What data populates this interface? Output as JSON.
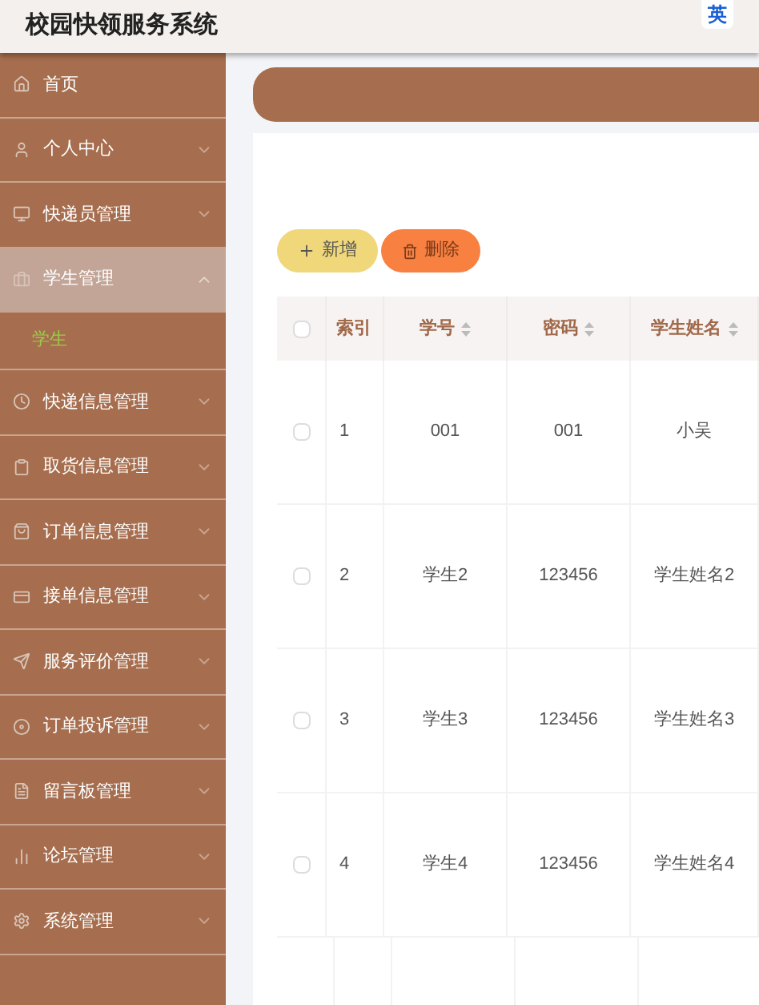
{
  "header": {
    "title": "校园快领服务系统",
    "ime_indicator": "英"
  },
  "sidebar": {
    "items": [
      {
        "label": "首页",
        "kind": "link",
        "selected": false
      },
      {
        "label": "个人中心",
        "kind": "menu",
        "selected": false,
        "expanded": false
      },
      {
        "label": "快递员管理",
        "kind": "menu",
        "selected": false,
        "expanded": false
      },
      {
        "label": "学生管理",
        "kind": "menu",
        "selected": true,
        "expanded": true,
        "children": [
          {
            "label": "学生",
            "selected": true
          }
        ]
      },
      {
        "label": "快递信息管理",
        "kind": "menu",
        "selected": false,
        "expanded": false
      },
      {
        "label": "取货信息管理",
        "kind": "menu",
        "selected": false,
        "expanded": false
      },
      {
        "label": "订单信息管理",
        "kind": "menu",
        "selected": false,
        "expanded": false
      },
      {
        "label": "接单信息管理",
        "kind": "menu",
        "selected": false,
        "expanded": false
      },
      {
        "label": "服务评价管理",
        "kind": "menu",
        "selected": false,
        "expanded": false
      },
      {
        "label": "订单投诉管理",
        "kind": "menu",
        "selected": false,
        "expanded": false
      },
      {
        "label": "留言板管理",
        "kind": "menu",
        "selected": false,
        "expanded": false
      },
      {
        "label": "论坛管理",
        "kind": "menu",
        "selected": false,
        "expanded": false
      },
      {
        "label": "系统管理",
        "kind": "menu",
        "selected": false,
        "expanded": false
      }
    ]
  },
  "toolbar": {
    "buttons": [
      {
        "label": "新增",
        "kind": "add"
      },
      {
        "label": "删除",
        "kind": "delete"
      }
    ]
  },
  "table": {
    "select_all_checked": false,
    "columns": [
      {
        "label": "索引",
        "sortable": false
      },
      {
        "label": "学号",
        "sortable": true
      },
      {
        "label": "密码",
        "sortable": true
      },
      {
        "label": "学生姓名",
        "sortable": true
      }
    ],
    "rows": [
      {
        "checked": false,
        "cells": [
          "1",
          "001",
          "001",
          "小吴"
        ]
      },
      {
        "checked": false,
        "cells": [
          "2",
          "学生2",
          "123456",
          "学生姓名2"
        ]
      },
      {
        "checked": false,
        "cells": [
          "3",
          "学生3",
          "123456",
          "学生姓名3"
        ]
      },
      {
        "checked": false,
        "cells": [
          "4",
          "学生4",
          "123456",
          "学生姓名4"
        ]
      }
    ]
  }
}
